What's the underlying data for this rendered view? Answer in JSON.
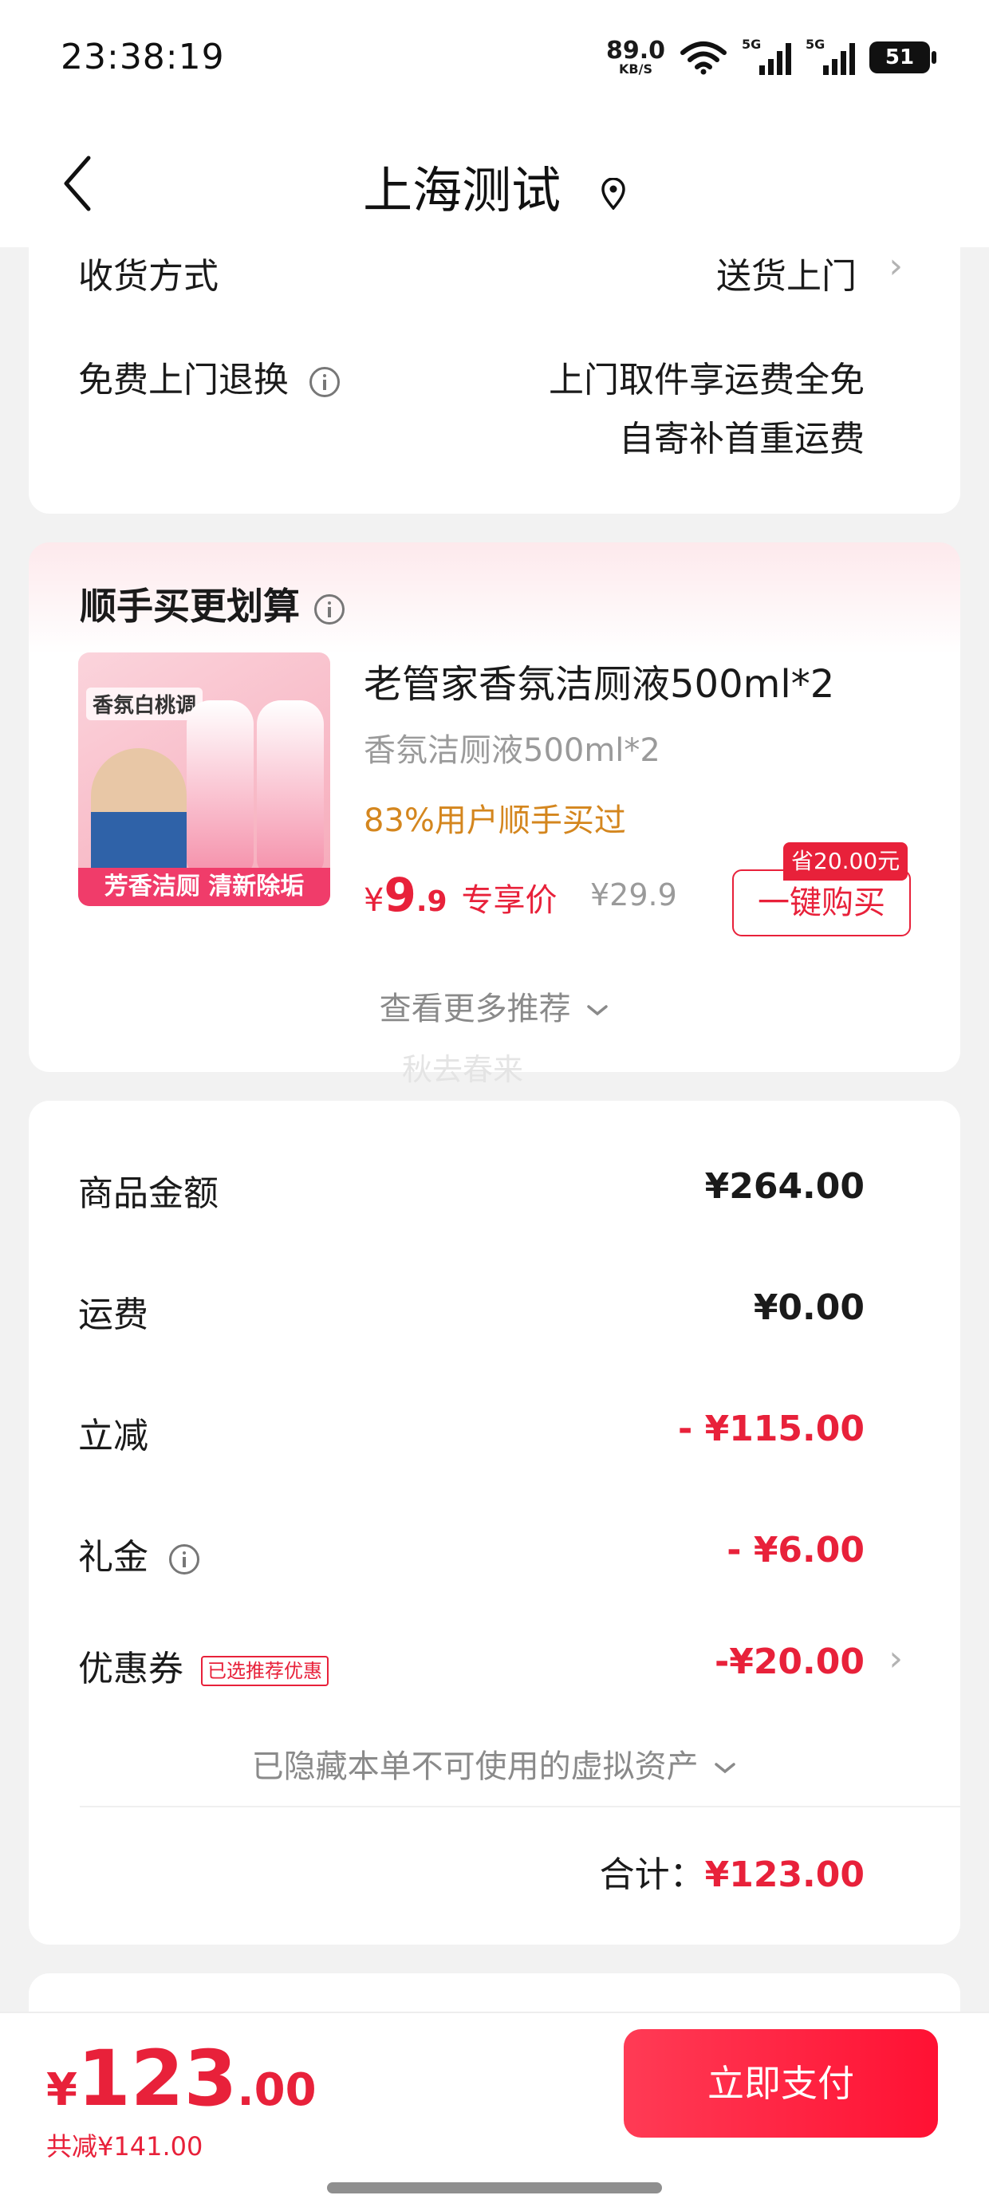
{
  "status_bar": {
    "time": "23:38:19",
    "net_speed": "89.0",
    "net_unit": "KB/S",
    "signal1_label": "5G",
    "signal2_label": "5G",
    "battery": "51"
  },
  "header": {
    "title": "上海测试",
    "back_icon": "chevron-left-icon",
    "location_icon": "location-pin-icon"
  },
  "delivery": {
    "method_label": "收货方式",
    "method_value": "送货上门",
    "return_label": "免费上门退换",
    "return_value_line1": "上门取件享运费全免",
    "return_value_line2": "自寄补首重运费"
  },
  "recommend": {
    "title": "顺手买更划算",
    "product": {
      "image_tag": "香氛白桃调",
      "image_slogan": "芳香洁厕 清新除垢",
      "name": "老管家香氛洁厕液500ml*2",
      "spec": "香氛洁厕液500ml*2",
      "buyers": "83%用户顺手买过",
      "price_currency": "¥",
      "price_int": "9",
      "price_dec": ".9",
      "price_label": "专享价",
      "original_price": "¥29.9",
      "save_tag": "省20.00元",
      "buy_button": "一键购买"
    },
    "more": "查看更多推荐",
    "watermark": "秋去春来"
  },
  "summary": {
    "goods_label": "商品金额",
    "goods_value": "¥264.00",
    "shipping_label": "运费",
    "shipping_value": "¥0.00",
    "instant_label": "立减",
    "instant_value": "- ¥115.00",
    "gift_label": "礼金",
    "gift_value": "- ¥6.00",
    "coupon_label": "优惠券",
    "coupon_badge": "已选推荐优惠",
    "coupon_value": "-¥20.00",
    "hidden_assets": "已隐藏本单不可使用的虚拟资产",
    "total_label": "合计：",
    "total_value": "¥123.00"
  },
  "bottom_bar": {
    "currency": "¥",
    "amount_int": "123",
    "amount_dec": ".00",
    "saved": "共减¥141.00",
    "pay_button": "立即支付"
  },
  "colors": {
    "accent": "#e8213a",
    "buyers_orange": "#d4861e",
    "background": "#f2f2f2"
  }
}
